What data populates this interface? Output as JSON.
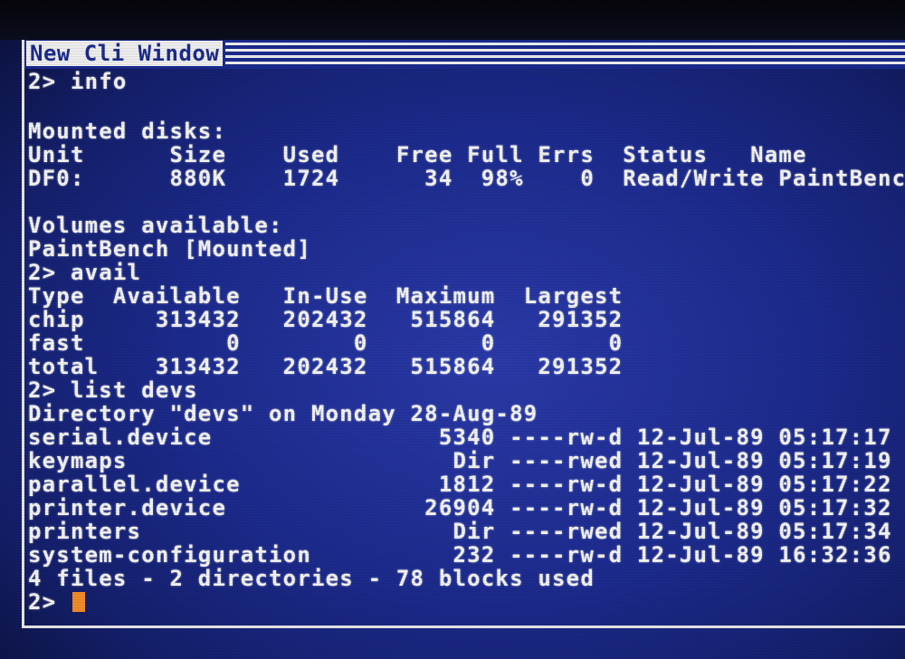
{
  "window": {
    "title": "New Cli Window"
  },
  "console": {
    "lines": [
      "2> info",
      "",
      "Mounted disks:",
      "Unit      Size    Used    Free Full Errs  Status   Name",
      "DF0:      880K    1724      34  98%    0  Read/Write PaintBench",
      "",
      "Volumes available:",
      "PaintBench [Mounted]",
      "2> avail",
      "Type  Available   In-Use  Maximum  Largest",
      "chip     313432   202432   515864   291352",
      "fast          0        0        0        0",
      "total    313432   202432   515864   291352",
      "2> list devs",
      "Directory \"devs\" on Monday 28-Aug-89",
      "serial.device                5340 ----rw-d 12-Jul-89 05:17:17",
      "keymaps                       Dir ----rwed 12-Jul-89 05:17:19",
      "parallel.device              1812 ----rw-d 12-Jul-89 05:17:22",
      "printer.device              26904 ----rw-d 12-Jul-89 05:17:32",
      "printers                      Dir ----rwed 12-Jul-89 05:17:34",
      "system-configuration          232 ----rw-d 12-Jul-89 16:32:36",
      "4 files - 2 directories - 78 blocks used"
    ],
    "prompt": "2>"
  },
  "colors": {
    "screen_blue": "#1c2a8c",
    "text": "#f2f2f2",
    "cursor": "#f08a2a"
  }
}
